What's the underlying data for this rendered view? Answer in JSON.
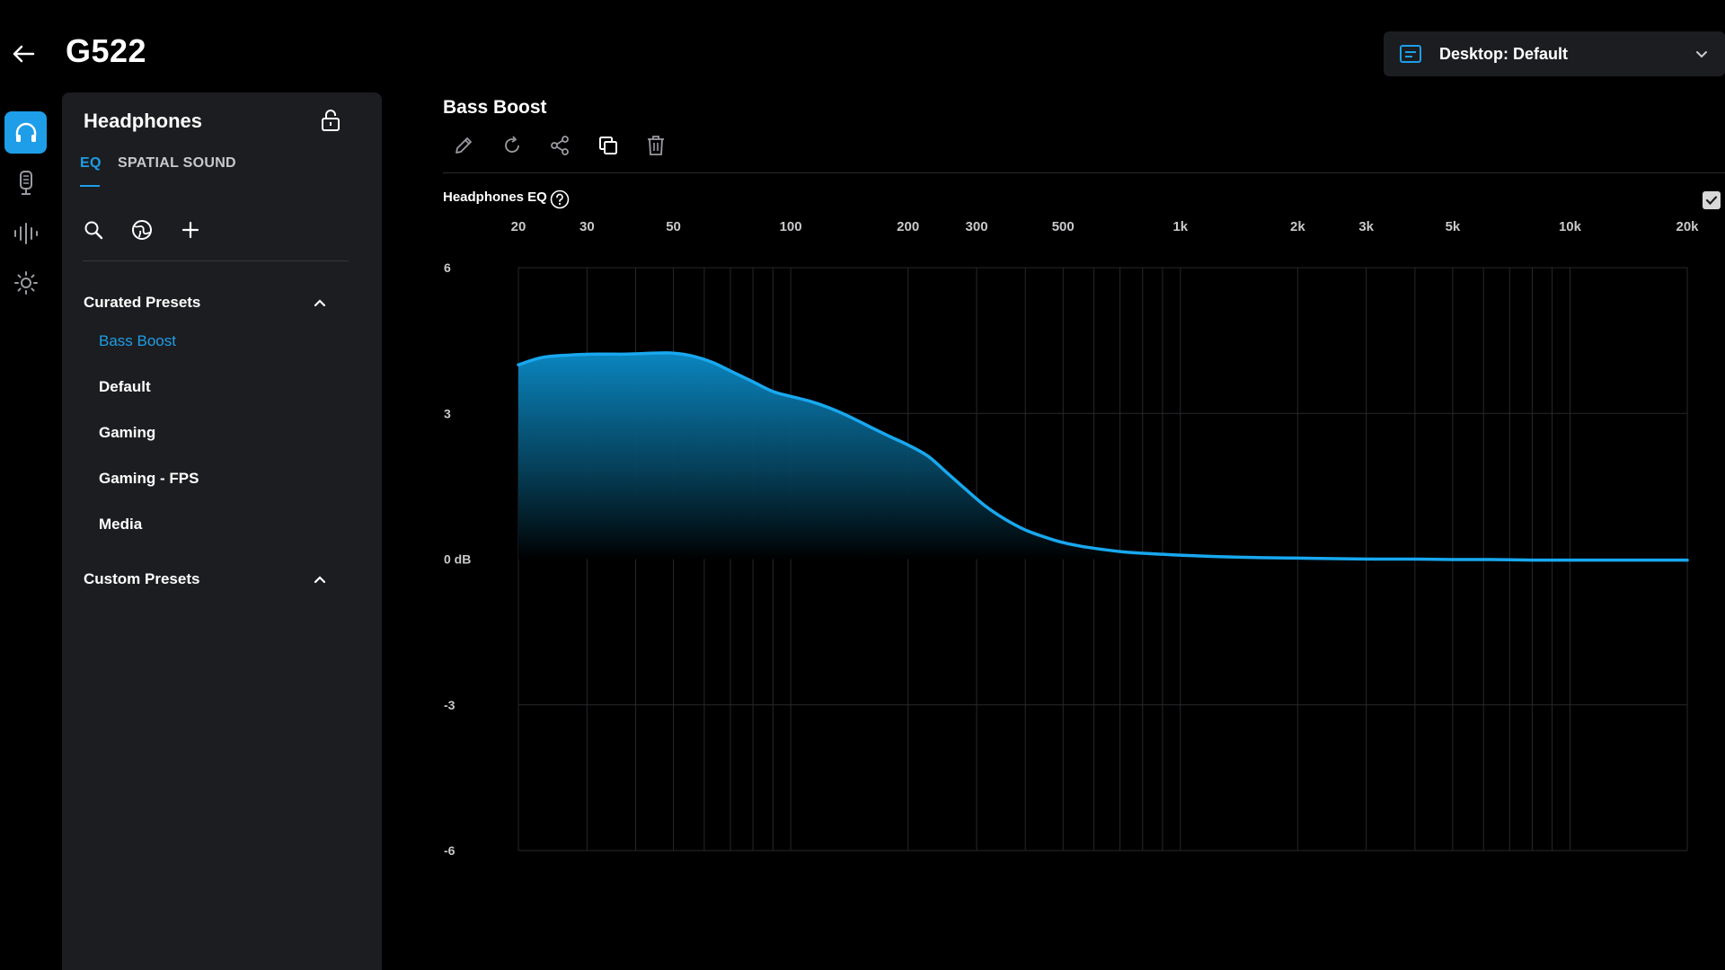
{
  "header": {
    "device_name": "G522",
    "profile": {
      "label": "Desktop: Default"
    }
  },
  "rail": {
    "items": [
      {
        "name": "headphones-icon",
        "active": true
      },
      {
        "name": "microphone-icon",
        "active": false
      },
      {
        "name": "equalizer-bars-icon",
        "active": false
      },
      {
        "name": "lighting-icon",
        "active": false
      }
    ]
  },
  "panel": {
    "title": "Headphones",
    "tabs": {
      "eq": "EQ",
      "spatial": "SPATIAL SOUND"
    },
    "curated": {
      "label": "Curated Presets",
      "items": [
        "Bass Boost",
        "Default",
        "Gaming",
        "Gaming - FPS",
        "Media"
      ],
      "selected": "Bass Boost"
    },
    "custom": {
      "label": "Custom Presets"
    }
  },
  "main": {
    "preset_title": "Bass Boost",
    "eq_label": "Headphones EQ",
    "eq_enabled": true
  },
  "colors": {
    "accent": "#1e9ee8",
    "curve": "#18a8f0",
    "panel_bg": "#1c1d20"
  },
  "chart_data": {
    "type": "area",
    "x_scale": "log",
    "xlim": [
      20,
      20000
    ],
    "ylim": [
      -6,
      6
    ],
    "x_tick_labels": [
      {
        "v": 20,
        "label": "20"
      },
      {
        "v": 30,
        "label": "30"
      },
      {
        "v": 50,
        "label": "50"
      },
      {
        "v": 100,
        "label": "100"
      },
      {
        "v": 200,
        "label": "200"
      },
      {
        "v": 300,
        "label": "300"
      },
      {
        "v": 500,
        "label": "500"
      },
      {
        "v": 1000,
        "label": "1k"
      },
      {
        "v": 2000,
        "label": "2k"
      },
      {
        "v": 3000,
        "label": "3k"
      },
      {
        "v": 5000,
        "label": "5k"
      },
      {
        "v": 10000,
        "label": "10k"
      },
      {
        "v": 20000,
        "label": "20k"
      }
    ],
    "y_tick_labels": [
      {
        "v": 6,
        "label": "6"
      },
      {
        "v": 3,
        "label": "3"
      },
      {
        "v": 0,
        "label": "0 dB"
      },
      {
        "v": -3,
        "label": "-3"
      },
      {
        "v": -6,
        "label": "-6"
      }
    ],
    "series": [
      {
        "x": [
          20,
          23,
          27,
          32,
          38,
          45,
          50,
          56,
          63,
          71,
          80,
          90,
          100,
          112,
          125,
          140,
          160,
          180,
          200,
          225,
          250,
          280,
          315,
          355,
          400,
          450,
          500,
          560,
          630,
          710,
          800,
          900,
          1000,
          1250,
          1600,
          2000,
          2500,
          3150,
          4000,
          5000,
          6300,
          8000,
          10000,
          12500,
          16000,
          20000
        ],
        "y": [
          4.0,
          4.15,
          4.2,
          4.22,
          4.22,
          4.24,
          4.24,
          4.18,
          4.05,
          3.85,
          3.65,
          3.45,
          3.35,
          3.25,
          3.12,
          2.95,
          2.72,
          2.52,
          2.35,
          2.12,
          1.8,
          1.45,
          1.1,
          0.82,
          0.6,
          0.45,
          0.34,
          0.26,
          0.2,
          0.15,
          0.12,
          0.1,
          0.08,
          0.05,
          0.03,
          0.02,
          0.01,
          0.0,
          0.0,
          -0.01,
          -0.01,
          -0.02,
          -0.02,
          -0.02,
          -0.02,
          -0.02
        ]
      }
    ]
  }
}
